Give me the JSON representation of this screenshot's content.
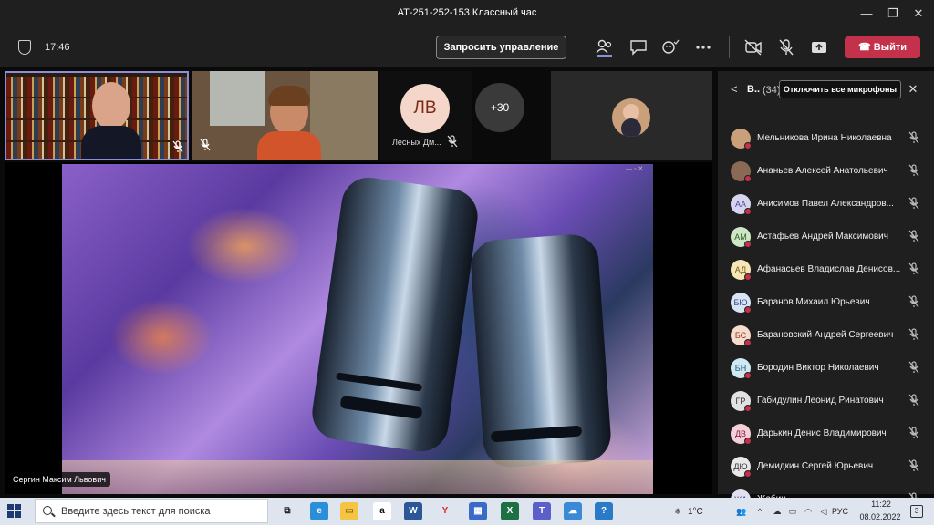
{
  "window": {
    "title": "АТ-251-252-153 Классный час",
    "minimize": "—",
    "maximize": "❐",
    "close": "✕"
  },
  "meeting": {
    "clock": "17:46",
    "request_control": "Запросить управление",
    "leave": "Выйти",
    "toolbar_icons": [
      "people-icon",
      "chat-icon",
      "reactions-icon",
      "more-icon",
      "camera-off-icon",
      "mic-off-icon",
      "share-icon"
    ]
  },
  "tiles": {
    "lv_initials": "ЛВ",
    "lv_name": "Лесных Дм...",
    "more_count": "+30"
  },
  "video": {
    "presenter": "Сергин Максим Львович",
    "corner_controls": "— ▫ ✕"
  },
  "panel": {
    "back": "<",
    "title": "В..",
    "count": "(34)",
    "mute_all": "Отключить все микрофоны",
    "close": "✕",
    "participants": [
      {
        "name": "Мельникова Ирина Николаевна",
        "initials": "",
        "bg": "#c9a07a",
        "fg": "#ffffff"
      },
      {
        "name": "Ананьев Алексей Анатольевич",
        "initials": "",
        "bg": "#8a6a55",
        "fg": "#ffffff"
      },
      {
        "name": "Анисимов Павел Александров...",
        "initials": "АА",
        "bg": "#d8d4f0",
        "fg": "#4b4a99"
      },
      {
        "name": "Астафьев Андрей Максимович",
        "initials": "АМ",
        "bg": "#cde6c6",
        "fg": "#2e5a22"
      },
      {
        "name": "Афанасьев Владислав Денисов...",
        "initials": "АД",
        "bg": "#f6e6b8",
        "fg": "#7a5a10"
      },
      {
        "name": "Баранов Михаил Юрьевич",
        "initials": "БЮ",
        "bg": "#d8e4f6",
        "fg": "#2a4a80"
      },
      {
        "name": "Барановский Андрей Сергеевич",
        "initials": "БС",
        "bg": "#f6dccd",
        "fg": "#8a3a1a"
      },
      {
        "name": "Бородин Виктор Николаевич",
        "initials": "БН",
        "bg": "#cfe8f2",
        "fg": "#1a5a7a"
      },
      {
        "name": "Габидулин Леонид Ринатович",
        "initials": "ГР",
        "bg": "#e2e2e2",
        "fg": "#333333"
      },
      {
        "name": "Дарькин Денис Владимирович",
        "initials": "ДВ",
        "bg": "#f4d0d8",
        "fg": "#8a1a3a"
      },
      {
        "name": "Демидкин Сергей Юрьевич",
        "initials": "ДЮ",
        "bg": "#e8e8e8",
        "fg": "#333333"
      },
      {
        "name": "Жабин...",
        "initials": "ЖА",
        "bg": "#e0e0f0",
        "fg": "#333366"
      }
    ]
  },
  "taskbar": {
    "search_placeholder": "Введите здесь текст для поиска",
    "apps": [
      {
        "name": "task-view-icon",
        "glyph": "⧉",
        "bg": "transparent",
        "fg": "#222222"
      },
      {
        "name": "edge-icon",
        "glyph": "e",
        "bg": "#2a8fd8",
        "fg": "#ffffff"
      },
      {
        "name": "file-explorer-icon",
        "glyph": "▭",
        "bg": "#f4c542",
        "fg": "#8a6a10"
      },
      {
        "name": "amazon-icon",
        "glyph": "a",
        "bg": "#ffffff",
        "fg": "#111111"
      },
      {
        "name": "word-icon",
        "glyph": "W",
        "bg": "#2b5797",
        "fg": "#ffffff"
      },
      {
        "name": "yandex-icon",
        "glyph": "Y",
        "bg": "transparent",
        "fg": "#e02020"
      },
      {
        "name": "store-icon",
        "glyph": "▦",
        "bg": "#3a6ac8",
        "fg": "#ffffff"
      },
      {
        "name": "excel-icon",
        "glyph": "X",
        "bg": "#1d7044",
        "fg": "#ffffff"
      },
      {
        "name": "teams-icon",
        "glyph": "T",
        "bg": "#5b5fc7",
        "fg": "#ffffff"
      },
      {
        "name": "weather-app-icon",
        "glyph": "☁",
        "bg": "#3a8ad8",
        "fg": "#ffffff"
      },
      {
        "name": "help-icon",
        "glyph": "?",
        "bg": "#2a7ac8",
        "fg": "#ffffff"
      }
    ],
    "weather": "1°C",
    "language": "РУС",
    "time": "11:22",
    "date": "08.02.2022",
    "notifications": "3"
  }
}
